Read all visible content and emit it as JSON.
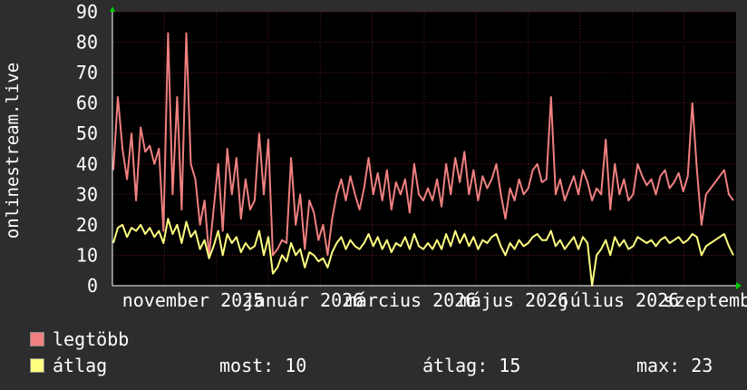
{
  "chart_data": {
    "type": "line",
    "ylabel": "onlinestream.live",
    "ylim": [
      0,
      90
    ],
    "yticks": [
      0,
      10,
      20,
      30,
      40,
      50,
      60,
      70,
      80,
      90
    ],
    "xticks": [
      "november 2025",
      "január 2026",
      "március 2026",
      "május 2026",
      "július 2026",
      "szeptember"
    ],
    "grid": true,
    "background": "#000000",
    "grid_color": "#5a1a1a",
    "series": [
      {
        "name": "legtöbb",
        "color": "#f08080",
        "values": [
          38,
          62,
          45,
          35,
          50,
          28,
          52,
          44,
          46,
          40,
          45,
          18,
          83,
          30,
          62,
          25,
          83,
          40,
          35,
          20,
          28,
          10,
          25,
          40,
          18,
          45,
          30,
          42,
          22,
          35,
          25,
          28,
          50,
          30,
          48,
          10,
          12,
          15,
          14,
          42,
          20,
          30,
          12,
          28,
          24,
          15,
          20,
          10,
          22,
          30,
          35,
          28,
          36,
          30,
          25,
          32,
          42,
          30,
          37,
          28,
          38,
          25,
          34,
          30,
          35,
          24,
          40,
          30,
          28,
          32,
          28,
          35,
          26,
          40,
          30,
          42,
          34,
          44,
          30,
          38,
          28,
          36,
          32,
          35,
          40,
          30,
          22,
          32,
          28,
          35,
          30,
          32,
          38,
          40,
          34,
          35,
          62,
          30,
          35,
          28,
          32,
          36,
          30,
          38,
          34,
          28,
          32,
          30,
          48,
          25,
          40,
          30,
          35,
          28,
          30,
          40,
          36,
          33,
          35,
          30,
          36,
          38,
          32,
          34,
          37,
          31,
          36,
          60,
          38,
          20,
          30,
          32,
          34,
          36,
          38,
          30,
          28
        ]
      },
      {
        "name": "átlag",
        "color": "#ffff80",
        "values": [
          14,
          19,
          20,
          16,
          19,
          18,
          20,
          17,
          19,
          16,
          18,
          14,
          22,
          17,
          20,
          14,
          21,
          16,
          18,
          12,
          15,
          9,
          13,
          18,
          10,
          17,
          14,
          16,
          11,
          14,
          12,
          13,
          18,
          10,
          16,
          4,
          6,
          10,
          8,
          14,
          10,
          12,
          6,
          11,
          10,
          8,
          9,
          6,
          11,
          14,
          16,
          12,
          15,
          13,
          12,
          14,
          17,
          13,
          16,
          12,
          15,
          11,
          14,
          13,
          16,
          12,
          17,
          13,
          12,
          14,
          12,
          15,
          12,
          17,
          13,
          18,
          14,
          17,
          13,
          16,
          12,
          15,
          14,
          16,
          17,
          13,
          10,
          14,
          12,
          15,
          13,
          14,
          16,
          17,
          15,
          15,
          18,
          13,
          15,
          12,
          14,
          16,
          12,
          16,
          14,
          0,
          10,
          12,
          15,
          10,
          16,
          13,
          15,
          12,
          13,
          16,
          15,
          14,
          15,
          13,
          15,
          16,
          14,
          15,
          16,
          14,
          15,
          17,
          16,
          10,
          13,
          14,
          15,
          16,
          17,
          13,
          10
        ]
      }
    ]
  },
  "legend": {
    "max_label": "legtöbb",
    "avg_label": "átlag",
    "max_color": "#f08080",
    "avg_color": "#ffff80"
  },
  "stats": {
    "now": "most: 10",
    "avg": "átlag: 15",
    "max": "max: 23"
  }
}
